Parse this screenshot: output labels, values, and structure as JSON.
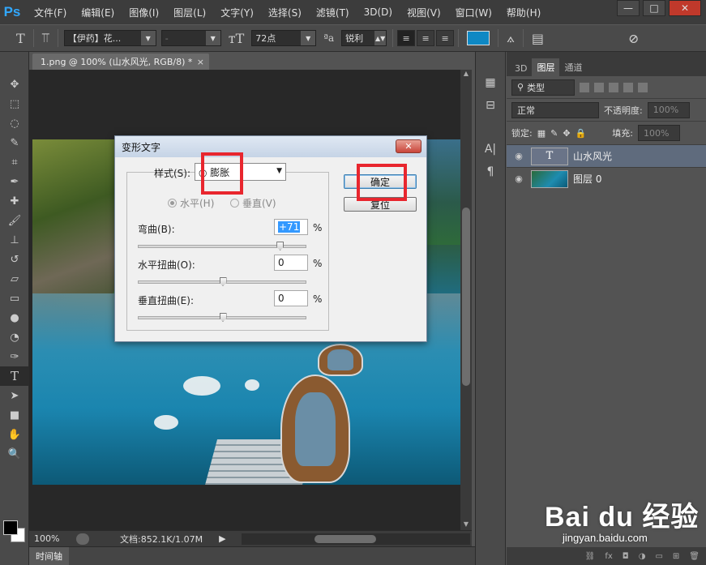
{
  "app": {
    "logo": "Ps",
    "menu": [
      "文件(F)",
      "编辑(E)",
      "图像(I)",
      "图层(L)",
      "文字(Y)",
      "选择(S)",
      "滤镜(T)",
      "3D(D)",
      "视图(V)",
      "窗口(W)",
      "帮助(H)"
    ],
    "window_controls": {
      "minimize": "—",
      "restore": "□",
      "close": "✕"
    }
  },
  "options_bar": {
    "font_family": "【伊药】花...",
    "font_style": "-",
    "font_size": "72点",
    "aa_label": "ªa",
    "anti_alias": "锐利",
    "text_color": "#0e88c4"
  },
  "document": {
    "tab_title": "1.png @ 100% (山水风光, RGB/8) *",
    "tab_close": "×",
    "zoom": "100%",
    "doc_info": "文档:852.1K/1.07M",
    "timeline_label": "时间轴"
  },
  "layers_panel": {
    "tabs": [
      "3D",
      "图层",
      "通道"
    ],
    "active_tab": "图层",
    "filter_kind": "类型",
    "blend_mode": "正常",
    "opacity_label": "不透明度:",
    "opacity_value": "100%",
    "lock_label": "锁定:",
    "fill_label": "填充:",
    "fill_value": "100%",
    "layers": [
      {
        "name": "山水风光",
        "type": "text",
        "thumb": "T",
        "selected": true
      },
      {
        "name": "图层 0",
        "type": "image",
        "thumb": "",
        "selected": false
      }
    ]
  },
  "warp_dialog": {
    "title": "变形文字",
    "close": "✕",
    "style_label": "样式(S):",
    "style_value": "◎ 膨胀",
    "horizontal_label": "水平(H)",
    "vertical_label": "垂直(V)",
    "bend_label": "弯曲(B):",
    "bend_value": "+71",
    "bend_percent": 71,
    "hdist_label": "水平扭曲(O):",
    "hdist_value": "0",
    "hdist_percent": 0,
    "vdist_label": "垂直扭曲(E):",
    "vdist_value": "0",
    "vdist_percent": 0,
    "percent_sign": "%",
    "ok_label": "确定",
    "reset_label": "复位"
  },
  "watermark": {
    "main": "Bai du 经验",
    "sub": "jingyan.baidu.com"
  }
}
